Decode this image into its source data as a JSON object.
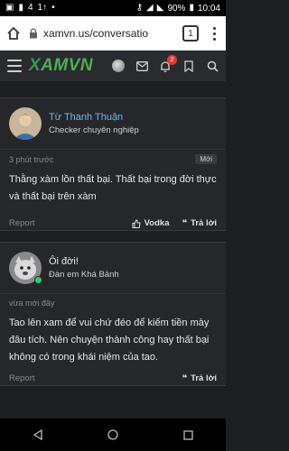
{
  "status_bar": {
    "signal_a": "4",
    "signal_b": "1",
    "battery": "90%",
    "time": "10:04"
  },
  "browser": {
    "url": "xamvn.us/conversatio",
    "tab_count": "1"
  },
  "site": {
    "logo_prefix": "X",
    "logo_rest": "AMVN",
    "notification_count": "2"
  },
  "posts": [
    {
      "author": "Từ Thanh Thuận",
      "author_title": "Checker chuyên nghiệp",
      "time": "3 phút trước",
      "badge": "Mới",
      "body": "Thằng xàm lồn thất bại. Thất bại trong đời thực và thất bại trên xàm",
      "report": "Report",
      "react": "Vodka",
      "reply": "Trả lời"
    },
    {
      "author": "Ôi đời!",
      "author_title": "Đàn em Khá Bảnh",
      "time": "vừa mới đây",
      "body": "Tao lên xam để vui chứ đéo để kiếm tiền mày đâu tích. Nên chuyện thành công hay thất bại không có trong khái niệm của tao.",
      "report": "Report",
      "reply": "Trả lời"
    }
  ],
  "colors": {
    "background": "#1d1e20",
    "card": "#26272a",
    "link": "#6fb7e6",
    "brand": "#4caf50",
    "badge_red": "#e53935"
  }
}
